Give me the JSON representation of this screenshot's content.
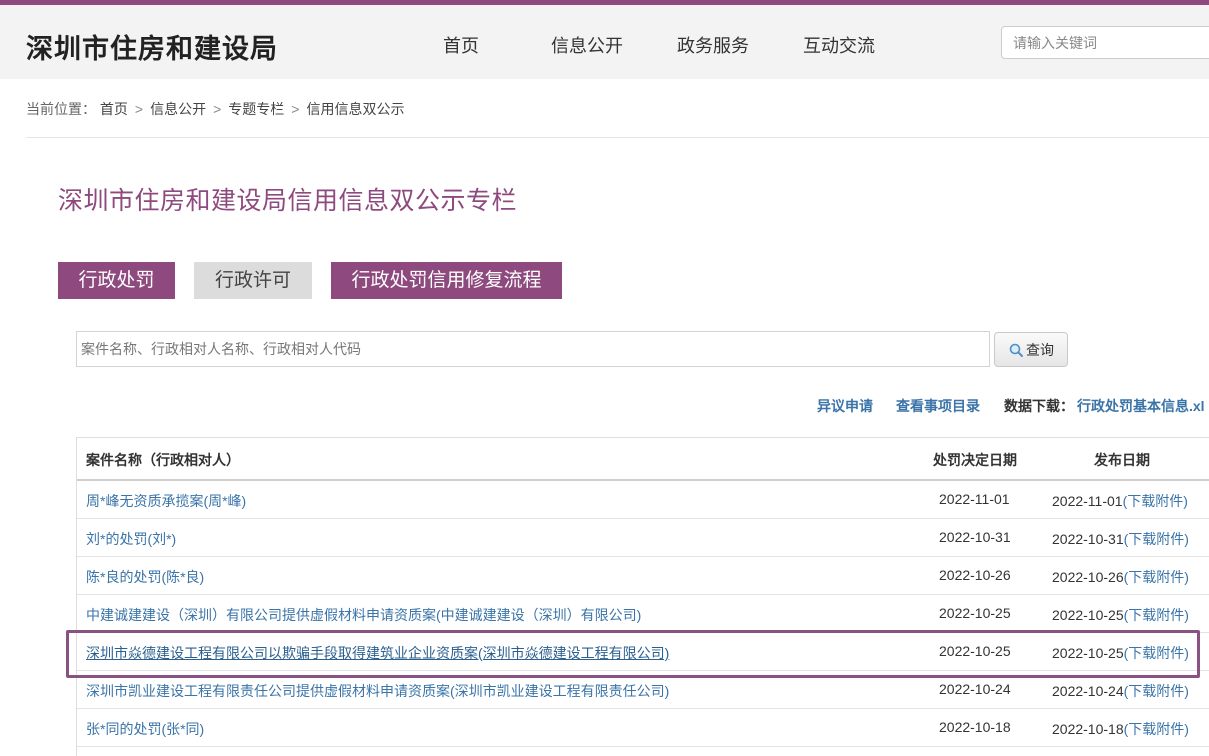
{
  "header": {
    "site_title": "深圳市住房和建设局",
    "nav": [
      "首页",
      "信息公开",
      "政务服务",
      "互动交流"
    ],
    "search_placeholder": "请输入关键词",
    "accent_color": "#8e4a7e"
  },
  "breadcrumb": {
    "prefix": "当前位置：",
    "items": [
      "首页",
      "信息公开",
      "专题专栏",
      "信用信息双公示"
    ],
    "separator": ">"
  },
  "page_title": "深圳市住房和建设局信用信息双公示专栏",
  "tabs": [
    {
      "label": "行政处罚",
      "active": true
    },
    {
      "label": "行政许可",
      "active": false
    },
    {
      "label": "行政处罚信用修复流程",
      "active": false
    }
  ],
  "case_search": {
    "placeholder": "案件名称、行政相对人名称、行政相对人代码",
    "button_label": "查询"
  },
  "links": {
    "objection": "异议申请",
    "catalog": "查看事项目录",
    "download_label": "数据下载：",
    "download_file": "行政处罚基本信息.xl"
  },
  "table": {
    "headers": [
      "案件名称（行政相对人）",
      "处罚决定日期",
      "发布日期"
    ],
    "attachment_label": "(下载附件)",
    "rows": [
      {
        "name": "周*峰无资质承揽案(周*峰)",
        "decision_date": "2022-11-01",
        "publish_date": "2022-11-01"
      },
      {
        "name": "刘*的处罚(刘*)",
        "decision_date": "2022-10-31",
        "publish_date": "2022-10-31"
      },
      {
        "name": "陈*良的处罚(陈*良)",
        "decision_date": "2022-10-26",
        "publish_date": "2022-10-26"
      },
      {
        "name": "中建诚建建设（深圳）有限公司提供虚假材料申请资质案(中建诚建建设（深圳）有限公司)",
        "decision_date": "2022-10-25",
        "publish_date": "2022-10-25"
      },
      {
        "name": "深圳市焱德建设工程有限公司以欺骗手段取得建筑业企业资质案(深圳市焱德建设工程有限公司)",
        "decision_date": "2022-10-25",
        "publish_date": "2022-10-25",
        "highlighted": true
      },
      {
        "name": "深圳市凯业建设工程有限责任公司提供虚假材料申请资质案(深圳市凯业建设工程有限责任公司)",
        "decision_date": "2022-10-24",
        "publish_date": "2022-10-24"
      },
      {
        "name": "张*同的处罚(张*同)",
        "decision_date": "2022-10-18",
        "publish_date": "2022-10-18"
      }
    ]
  }
}
